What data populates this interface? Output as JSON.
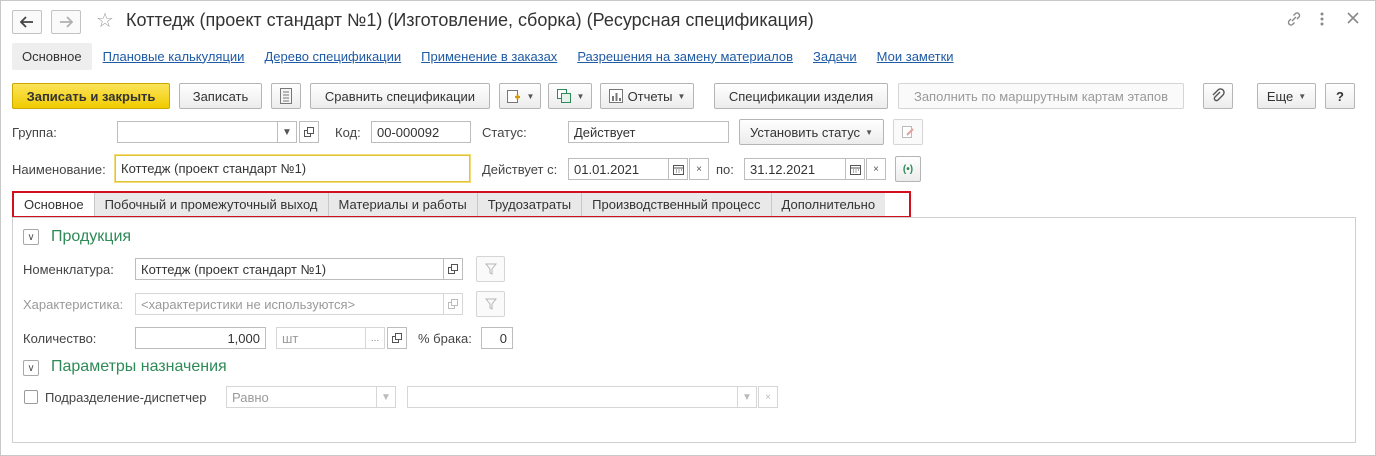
{
  "window": {
    "title": "Коттедж (проект стандарт №1) (Изготовление, сборка) (Ресурсная спецификация)",
    "back_icon": "arrow-left-icon",
    "forward_icon": "arrow-right-icon"
  },
  "nav": {
    "items": [
      {
        "label": "Основное"
      },
      {
        "label": "Плановые калькуляции"
      },
      {
        "label": "Дерево спецификации"
      },
      {
        "label": "Применение в заказах"
      },
      {
        "label": "Разрешения на замену материалов"
      },
      {
        "label": "Задачи"
      },
      {
        "label": "Мои заметки"
      }
    ]
  },
  "toolbar": {
    "save_close": "Записать и закрыть",
    "save": "Записать",
    "compare": "Сравнить спецификации",
    "reports": "Отчеты",
    "item_specs": "Спецификации изделия",
    "fill_by_routes": "Заполнить по маршрутным картам этапов",
    "more": "Еще",
    "help": "?"
  },
  "form": {
    "group_label": "Группа:",
    "group_value": "",
    "code_label": "Код:",
    "code_value": "00-000092",
    "status_label": "Статус:",
    "status_value": "Действует",
    "set_status": "Установить статус",
    "name_label": "Наименование:",
    "name_value": "Коттедж (проект стандарт №1)",
    "valid_from_label": "Действует с:",
    "valid_from_value": "01.01.2021",
    "valid_to_label": "по:",
    "valid_to_value": "31.12.2021"
  },
  "tabs": [
    {
      "label": "Основное"
    },
    {
      "label": "Побочный и промежуточный выход"
    },
    {
      "label": "Материалы и работы"
    },
    {
      "label": "Трудозатраты"
    },
    {
      "label": "Производственный процесс"
    },
    {
      "label": "Дополнительно"
    }
  ],
  "production": {
    "section_title": "Продукция",
    "nomenclature_label": "Номенклатура:",
    "nomenclature_value": "Коттедж (проект стандарт №1)",
    "characteristic_label": "Характеристика:",
    "characteristic_value": "<характеристики не используются>",
    "quantity_label": "Количество:",
    "quantity_value": "1,000",
    "unit_value": "шт",
    "unit_button": "...",
    "defect_label": "% брака:",
    "defect_value": "0"
  },
  "assignment": {
    "section_title": "Параметры назначения",
    "dispatcher_label": "Подразделение-диспетчер",
    "condition_value": "Равно",
    "dispatcher_value": ""
  }
}
